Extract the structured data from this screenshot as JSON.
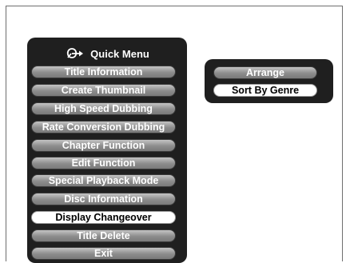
{
  "quick_menu": {
    "title": "Quick Menu",
    "title_icon": "remote-pointer-icon",
    "items": [
      {
        "label": "Title Information",
        "selected": false
      },
      {
        "label": "Create Thumbnail",
        "selected": false
      },
      {
        "label": "High Speed Dubbing",
        "selected": false
      },
      {
        "label": "Rate Conversion  Dubbing",
        "selected": false
      },
      {
        "label": "Chapter Function",
        "selected": false
      },
      {
        "label": "Edit Function",
        "selected": false
      },
      {
        "label": "Special Playback Mode",
        "selected": false
      },
      {
        "label": "Disc Information",
        "selected": false
      },
      {
        "label": "Display Changeover",
        "selected": true
      },
      {
        "label": "Title Delete",
        "selected": false
      },
      {
        "label": "Exit",
        "selected": false
      }
    ]
  },
  "sort_menu": {
    "items": [
      {
        "label": "Arrange",
        "selected": false
      },
      {
        "label": "Sort By Genre",
        "selected": true
      }
    ]
  },
  "colors": {
    "panel": "#1f1f1f",
    "item": "#8c8c8c",
    "selected_item": "#ffffff"
  }
}
